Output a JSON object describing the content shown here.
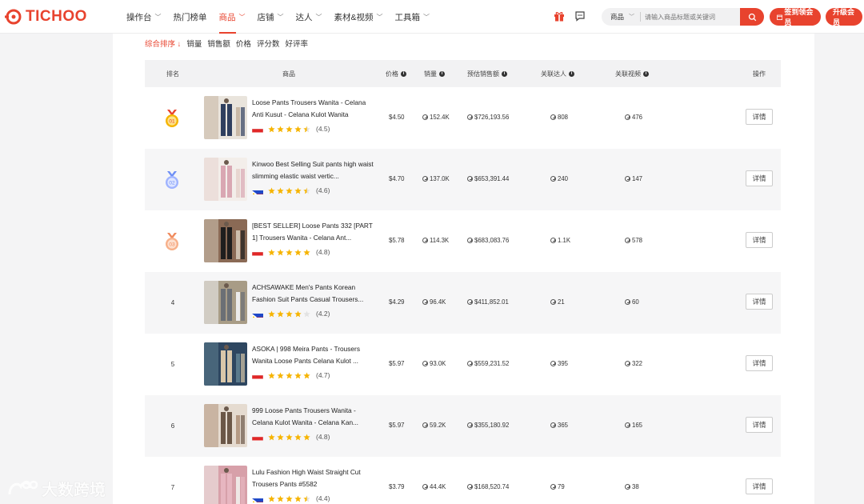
{
  "brand": {
    "name": "TICHOO",
    "accent": "#e8432e"
  },
  "nav": {
    "items": [
      {
        "label": "操作台",
        "dropdown": true
      },
      {
        "label": "热门榜单",
        "dropdown": false
      },
      {
        "label": "商品",
        "dropdown": true,
        "active": true
      },
      {
        "label": "店铺",
        "dropdown": true
      },
      {
        "label": "达人",
        "dropdown": true
      },
      {
        "label": "素材&视频",
        "dropdown": true
      },
      {
        "label": "工具箱",
        "dropdown": true
      }
    ]
  },
  "search": {
    "category": "商品",
    "placeholder": "请输入商品标题或关键词"
  },
  "buttons": {
    "signin": "签到领会员",
    "upgrade": "升级会员",
    "detail": "详情"
  },
  "sort": {
    "items": [
      {
        "label": "综合排序 ↓",
        "active": true
      },
      {
        "label": "销量"
      },
      {
        "label": "销售额"
      },
      {
        "label": "价格"
      },
      {
        "label": "评分数"
      },
      {
        "label": "好评率"
      }
    ]
  },
  "table": {
    "headers": {
      "rank": "排名",
      "product": "商品",
      "price": "价格",
      "sales": "销量",
      "revenue": "预估销售额",
      "creators": "关联达人",
      "videos": "关联视频",
      "action": "操作"
    },
    "rows": [
      {
        "rank": "01",
        "medal": "gold",
        "name": "Loose Pants Trousers Wanita - Celana Anti Kusut - Celana Kulot Wanita",
        "flag": "id",
        "stars": 4.5,
        "rating": "(4.5)",
        "price": "$4.50",
        "sales": "152.4K",
        "revenue": "$726,193.56",
        "creators": "808",
        "videos": "476",
        "thumb": "thumb-1"
      },
      {
        "rank": "02",
        "medal": "silver",
        "name": "Kinwoo Best Selling Suit pants high waist slimming elastic waist vertic...",
        "flag": "ph",
        "stars": 4.5,
        "rating": "(4.6)",
        "price": "$4.70",
        "sales": "137.0K",
        "revenue": "$653,391.44",
        "creators": "240",
        "videos": "147",
        "thumb": "thumb-2"
      },
      {
        "rank": "03",
        "medal": "bronze",
        "name": "[BEST SELLER] Loose Pants 332 [PART 1] Trousers Wanita - Celana Ant...",
        "flag": "id",
        "stars": 5,
        "rating": "(4.8)",
        "price": "$5.78",
        "sales": "114.3K",
        "revenue": "$683,083.76",
        "creators": "1.1K",
        "videos": "578",
        "thumb": "thumb-3"
      },
      {
        "rank": "4",
        "medal": "",
        "name": "ACHSAWAKE Men's Pants Korean Fashion Suit Pants Casual Trousers...",
        "flag": "ph",
        "stars": 4,
        "rating": "(4.2)",
        "price": "$4.29",
        "sales": "96.4K",
        "revenue": "$411,852.01",
        "creators": "21",
        "videos": "60",
        "thumb": "thumb-4"
      },
      {
        "rank": "5",
        "medal": "",
        "name": "ASOKA | 998 Meira Pants - Trousers Wanita Loose Pants Celana Kulot ...",
        "flag": "id",
        "stars": 5,
        "rating": "(4.7)",
        "price": "$5.97",
        "sales": "93.0K",
        "revenue": "$559,231.52",
        "creators": "395",
        "videos": "322",
        "thumb": "thumb-5"
      },
      {
        "rank": "6",
        "medal": "",
        "name": "999 Loose Pants Trousers Wanita - Celana Kulot Wanita - Celana Kan...",
        "flag": "id",
        "stars": 5,
        "rating": "(4.8)",
        "price": "$5.97",
        "sales": "59.2K",
        "revenue": "$355,180.92",
        "creators": "365",
        "videos": "165",
        "thumb": "thumb-6"
      },
      {
        "rank": "7",
        "medal": "",
        "name": "Lulu Fashion High Waist Straight Cut Trousers Pants #5582",
        "flag": "ph",
        "stars": 4.5,
        "rating": "(4.4)",
        "price": "$3.79",
        "sales": "44.4K",
        "revenue": "$168,520.74",
        "creators": "79",
        "videos": "38",
        "thumb": "thumb-7"
      }
    ]
  },
  "watermark": {
    "text": "大数跨境"
  }
}
